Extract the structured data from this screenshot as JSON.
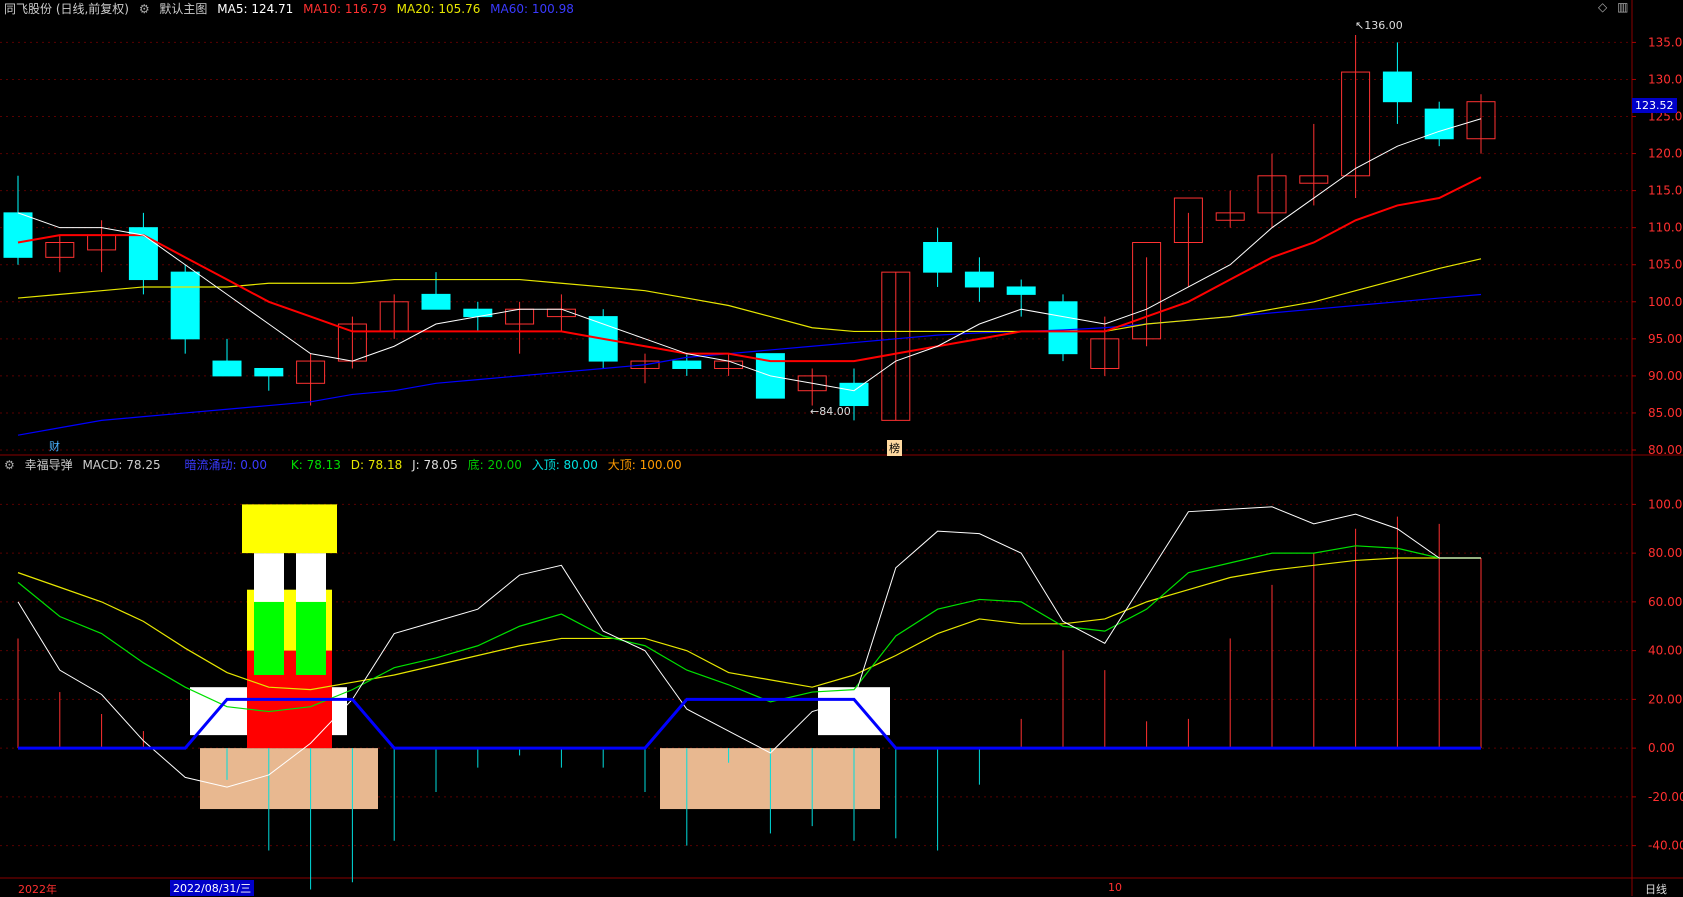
{
  "main_header": {
    "stock": "同飞股份 (日线,前复权)",
    "chart_name": "默认主图",
    "ma5": "MA5: 124.71",
    "ma10": "MA10: 116.79",
    "ma20": "MA20: 105.76",
    "ma60": "MA60: 100.98"
  },
  "sub_header": {
    "indicator": "幸福导弹",
    "macd": "MACD: 78.25",
    "signal": "暗流涌动: 0.00",
    "k": "K: 78.13",
    "d": "D: 78.18",
    "j": "J: 78.05",
    "bottom": "底: 20.00",
    "entry": "入顶: 80.00",
    "top": "大顶: 100.00"
  },
  "main_axis_ticks": [
    "135.00",
    "130.00",
    "125.00",
    "120.00",
    "115.00",
    "110.00",
    "105.00",
    "100.00",
    "95.00",
    "90.00",
    "85.00",
    "80.00"
  ],
  "sub_axis_ticks": [
    "100.00",
    "80.00",
    "60.00",
    "40.00",
    "20.00",
    "0.00",
    "-20.00",
    "-40.00"
  ],
  "current_price": "123.52",
  "high_label": "136.00",
  "low_label": "84.00",
  "marker_cai": "财",
  "marker_bang": "榜",
  "x_labels": {
    "year": "2022年",
    "date": "2022/08/31/三",
    "month": "10",
    "period": "日线"
  },
  "colors": {
    "up": "#ff3232",
    "down": "#00ffff",
    "ma5": "#ffffff",
    "ma10": "#ff0000",
    "ma20": "#e6e600",
    "ma60": "#0000ff",
    "bg": "#000000",
    "grid": "#5a0000"
  },
  "chart_data": {
    "type": "candlestick",
    "ylim": [
      80,
      136
    ],
    "candles": [
      [
        112,
        117,
        105,
        106
      ],
      [
        106,
        109,
        104,
        108
      ],
      [
        107,
        111,
        104,
        109
      ],
      [
        110,
        112,
        101,
        103
      ],
      [
        104,
        105,
        93,
        95
      ],
      [
        92,
        95,
        90,
        90
      ],
      [
        91,
        91,
        88,
        90
      ],
      [
        89,
        93,
        86,
        92
      ],
      [
        92,
        98,
        91,
        97
      ],
      [
        96,
        101,
        95,
        100
      ],
      [
        101,
        104,
        99,
        99
      ],
      [
        99,
        100,
        96,
        98
      ],
      [
        97,
        100,
        93,
        99
      ],
      [
        98,
        101,
        96,
        99
      ],
      [
        98,
        99,
        91,
        92
      ],
      [
        91,
        93,
        89,
        92
      ],
      [
        92,
        93,
        90,
        91
      ],
      [
        91,
        93,
        90,
        92
      ],
      [
        93,
        93,
        87,
        87
      ],
      [
        88,
        91,
        86,
        90
      ],
      [
        89,
        91,
        84,
        86
      ],
      [
        84,
        104,
        84,
        104
      ],
      [
        108,
        110,
        102,
        104
      ],
      [
        104,
        106,
        100,
        102
      ],
      [
        102,
        103,
        98,
        101
      ],
      [
        100,
        101,
        92,
        93
      ],
      [
        91,
        98,
        90,
        95
      ],
      [
        95,
        106,
        94,
        108
      ],
      [
        108,
        112,
        102,
        114
      ],
      [
        111,
        115,
        110,
        112
      ],
      [
        112,
        120,
        110,
        117
      ],
      [
        116,
        124,
        113,
        117
      ],
      [
        117,
        136,
        114,
        131
      ],
      [
        131,
        135,
        124,
        127
      ],
      [
        126,
        127,
        121,
        122
      ],
      [
        122,
        128,
        120,
        127
      ]
    ],
    "ma5": [
      112,
      110,
      110,
      109,
      105,
      101,
      97,
      93,
      92,
      94,
      97,
      98,
      99,
      99,
      97,
      95,
      93,
      92,
      90,
      89,
      88,
      92,
      94,
      97,
      99,
      98,
      97,
      99,
      102,
      105,
      110,
      114,
      118,
      121,
      123,
      124.7
    ],
    "ma10": [
      108,
      109,
      109,
      109,
      106,
      103,
      100,
      98,
      96,
      96,
      96,
      96,
      96,
      96,
      95,
      94,
      93,
      93,
      92,
      92,
      92,
      93,
      94,
      95,
      96,
      96,
      96,
      98,
      100,
      103,
      106,
      108,
      111,
      113,
      114,
      116.8
    ],
    "ma20": [
      100.5,
      101,
      101.5,
      102,
      102,
      102,
      102.5,
      102.5,
      102.5,
      103,
      103,
      103,
      103,
      102.5,
      102,
      101.5,
      100.5,
      99.5,
      98,
      96.5,
      96,
      96,
      96,
      96,
      96,
      96,
      96,
      97,
      97.5,
      98,
      99,
      100,
      101.5,
      103,
      104.5,
      105.8
    ],
    "ma60": [
      82,
      83,
      84,
      84.5,
      85,
      85.5,
      86,
      86.5,
      87.5,
      88,
      89,
      89.5,
      90,
      90.5,
      91,
      91.5,
      92.5,
      93,
      93.5,
      94,
      94.5,
      95,
      95.5,
      95.8,
      96,
      96.2,
      96.5,
      97,
      97.5,
      98,
      98.5,
      99,
      99.5,
      100,
      100.5,
      100.98
    ],
    "macd_ylim": [
      -50,
      110
    ],
    "macd_bars": [
      45,
      23,
      14,
      7,
      0,
      -13,
      -42,
      -58,
      -55,
      -38,
      -18,
      -8,
      -3,
      -8,
      -8,
      -18,
      -40,
      -6,
      -35,
      -32,
      -38,
      -37,
      -42,
      -15,
      12,
      40,
      32,
      11,
      12,
      45,
      67,
      80,
      90,
      95,
      92,
      78
    ],
    "k_line": [
      60,
      32,
      22,
      3,
      -12,
      -16,
      -11,
      2,
      20,
      47,
      52,
      57,
      71,
      75,
      48,
      40,
      16,
      7,
      -2,
      15,
      20,
      74,
      89,
      88,
      80,
      52,
      43,
      70,
      97,
      98,
      99,
      92,
      96,
      90,
      78,
      78
    ],
    "d_line": [
      68,
      54,
      47,
      35,
      25,
      17,
      15,
      17,
      24,
      33,
      37,
      42,
      50,
      55,
      46,
      42,
      32,
      26,
      19,
      23,
      24,
      46,
      57,
      61,
      60,
      50,
      48,
      57,
      72,
      76,
      80,
      80,
      83,
      82,
      78,
      78
    ],
    "j_line": [
      72,
      66,
      60,
      52,
      41,
      31,
      25,
      24,
      27,
      30,
      34,
      38,
      42,
      45,
      45,
      45,
      40,
      31,
      28,
      25,
      30,
      38,
      47,
      53,
      51,
      51,
      53,
      60,
      65,
      70,
      73,
      75,
      77,
      78,
      78,
      78
    ],
    "blue_line": [
      0,
      0,
      0,
      0,
      0,
      20,
      20,
      20,
      20,
      0,
      0,
      0,
      0,
      0,
      0,
      0,
      20,
      20,
      20,
      20,
      20,
      0,
      0,
      0,
      0,
      0,
      0,
      0,
      0,
      0,
      0,
      0,
      0,
      0,
      0,
      0
    ]
  }
}
